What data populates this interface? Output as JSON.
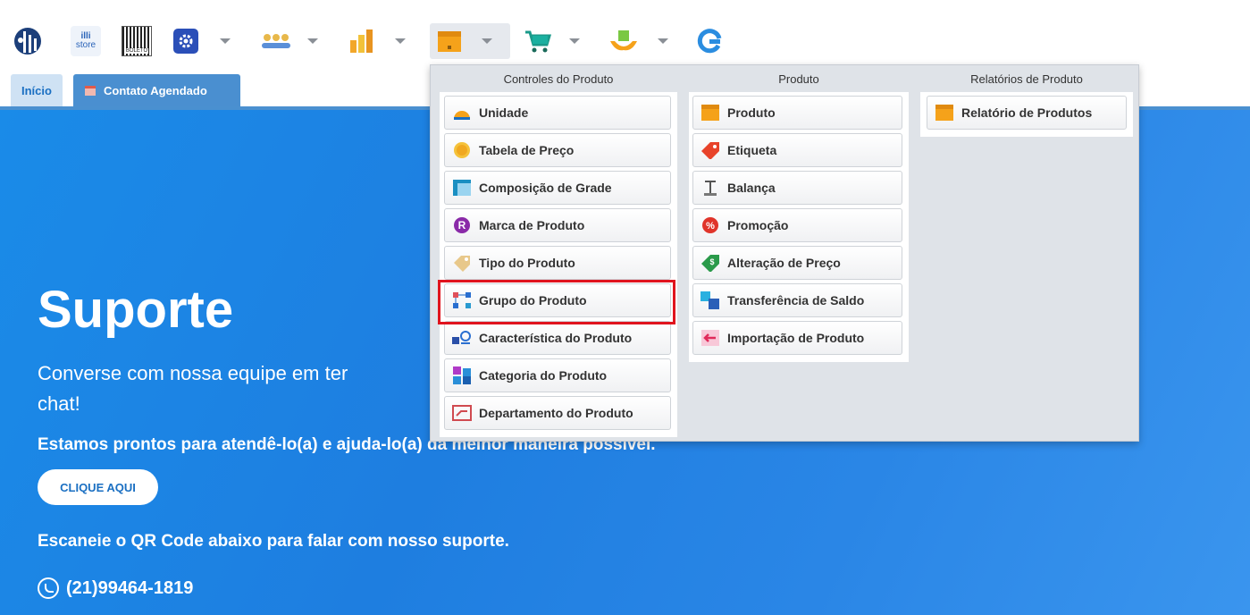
{
  "toolbar": {
    "logo_alt": "logo",
    "store_label_1": "illi",
    "store_label_2": "store",
    "boleto_label": "BOLETO",
    "icons": [
      "app-logo-icon",
      "illi-store-icon",
      "boleto-barcode-icon",
      "settings-icon",
      "people-icon",
      "bar-chart-icon",
      "product-box-icon",
      "cart-icon",
      "hands-box-icon",
      "refresh-g-icon"
    ]
  },
  "tabs": {
    "home": "Início",
    "contact": "Contato Agendado"
  },
  "hero": {
    "title": "Suporte",
    "subtitle_visible": "Converse com nossa equipe em ter",
    "subtitle_tail": "chat!",
    "line2": "Estamos prontos para atendê-lo(a) e ajuda-lo(a) da melhor maneira possível.",
    "cta": "CLIQUE AQUI",
    "scan": "Escaneie o QR Code abaixo para falar com nosso suporte.",
    "phone": "(21)99464-1819"
  },
  "dropdown": {
    "col1": {
      "heading": "Controles do Produto",
      "items": [
        "Unidade",
        "Tabela de Preço",
        "Composição de Grade",
        "Marca de Produto",
        "Tipo do Produto",
        "Grupo do Produto",
        "Característica do Produto",
        "Categoria do Produto",
        "Departamento do Produto"
      ]
    },
    "col2": {
      "heading": "Produto",
      "items": [
        "Produto",
        "Etiqueta",
        "Balança",
        "Promoção",
        "Alteração de Preço",
        "Transferência de Saldo",
        "Importação de Produto"
      ]
    },
    "col3": {
      "heading": "Relatórios de Produto",
      "items": [
        "Relatório de Produtos"
      ]
    }
  },
  "colors": {
    "accent": "#1a8be8",
    "highlight": "#e0141e",
    "tab_active": "#4a8fd0"
  }
}
